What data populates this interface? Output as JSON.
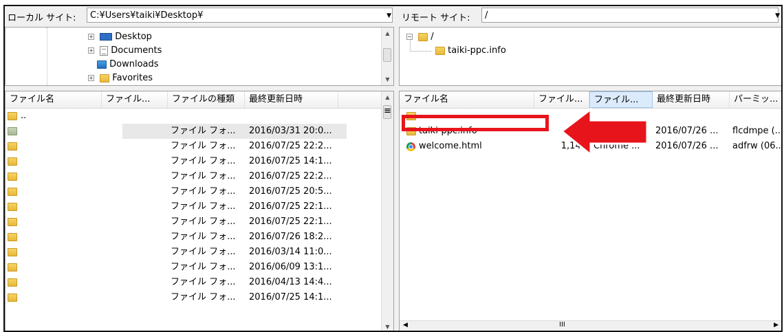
{
  "local": {
    "site_label": "ローカル サイト:",
    "path": "C:¥Users¥taiki¥Desktop¥",
    "tree": [
      {
        "label": "Desktop",
        "icon": "desktop-icon"
      },
      {
        "label": "Documents",
        "icon": "documents-icon"
      },
      {
        "label": "Downloads",
        "icon": "downloads-icon"
      },
      {
        "label": "Favorites",
        "icon": "favorites-icon"
      }
    ],
    "columns": [
      "ファイル名",
      "ファイル...",
      "ファイルの種類",
      "最終更新日時"
    ],
    "rows": [
      {
        "name": "..",
        "type": "",
        "modified": ""
      },
      {
        "name": "",
        "type": "ファイル フォ...",
        "modified": "2016/03/31 20:0..."
      },
      {
        "name": "",
        "type": "ファイル フォ...",
        "modified": "2016/07/25 22:2..."
      },
      {
        "name": "",
        "type": "ファイル フォ...",
        "modified": "2016/07/25 14:1..."
      },
      {
        "name": "",
        "type": "ファイル フォ...",
        "modified": "2016/07/25 22:2..."
      },
      {
        "name": "",
        "type": "ファイル フォ...",
        "modified": "2016/07/25 20:5..."
      },
      {
        "name": "",
        "type": "ファイル フォ...",
        "modified": "2016/07/25 22:1..."
      },
      {
        "name": "",
        "type": "ファイル フォ...",
        "modified": "2016/07/25 22:1..."
      },
      {
        "name": "",
        "type": "ファイル フォ...",
        "modified": "2016/07/26 18:2..."
      },
      {
        "name": "",
        "type": "ファイル フォ...",
        "modified": "2016/03/14 11:0..."
      },
      {
        "name": "",
        "type": "ファイル フォ...",
        "modified": "2016/06/09 13:1..."
      },
      {
        "name": "",
        "type": "ファイル フォ...",
        "modified": "2016/04/13 14:4..."
      },
      {
        "name": "",
        "type": "ファイル フォ...",
        "modified": "2016/07/25 14:1..."
      }
    ]
  },
  "remote": {
    "site_label": "リモート サイト:",
    "path": "/",
    "tree": [
      {
        "label": "/"
      },
      {
        "label": "taiki-ppc.info"
      }
    ],
    "columns": [
      "ファイル名",
      "ファイル...",
      "ファイル...",
      "最終更新日時",
      "パーミッ..."
    ],
    "rows": [
      {
        "name": "..",
        "size": "",
        "type": "",
        "modified": "",
        "perm": ""
      },
      {
        "name": "taiki-ppc.info",
        "size": "",
        "type": "",
        "modified": "2016/07/26 ...",
        "perm": "flcdmpe (..."
      },
      {
        "name": "welcome.html",
        "size": "1,141",
        "type": "Chrome ...",
        "modified": "2016/07/26 ...",
        "perm": "adfrw (06..."
      }
    ],
    "hscroll_mid": "III"
  },
  "annotation": {
    "highlight_color": "#e8141c",
    "arrow_color": "#e8141c"
  }
}
